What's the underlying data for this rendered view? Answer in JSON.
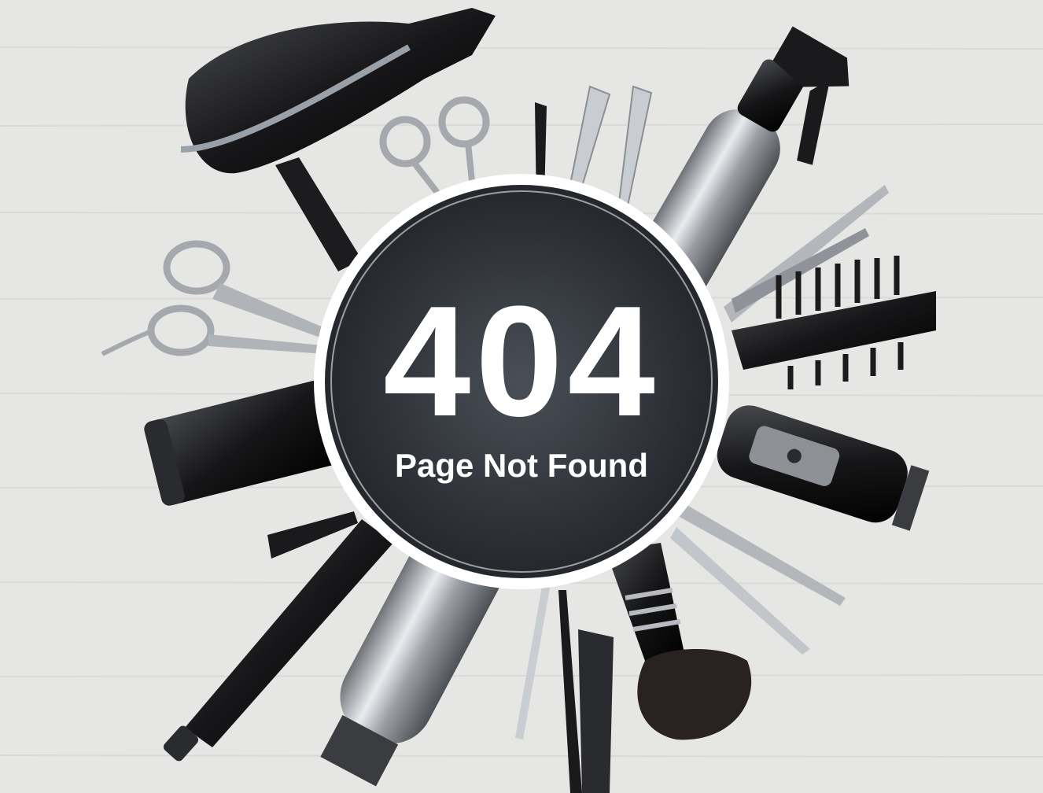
{
  "error": {
    "code": "404",
    "message": "Page Not Found"
  },
  "colors": {
    "background": "#e6e6e4",
    "badge": "#2b2e33",
    "badge_ring": "#ffffff",
    "tool_dark": "#1c1c1e",
    "tool_metal": "#a9adb3",
    "text": "#ffffff"
  },
  "icons": [
    "hair-dryer-icon",
    "spray-bottle-icon",
    "scissors-icon",
    "thinning-shears-icon",
    "comb-icon",
    "hair-clipper-icon",
    "curling-iron-icon",
    "shaving-brush-icon",
    "hair-clip-icon",
    "tail-comb-icon",
    "cosmetic-tube-icon",
    "aerosol-can-icon"
  ]
}
